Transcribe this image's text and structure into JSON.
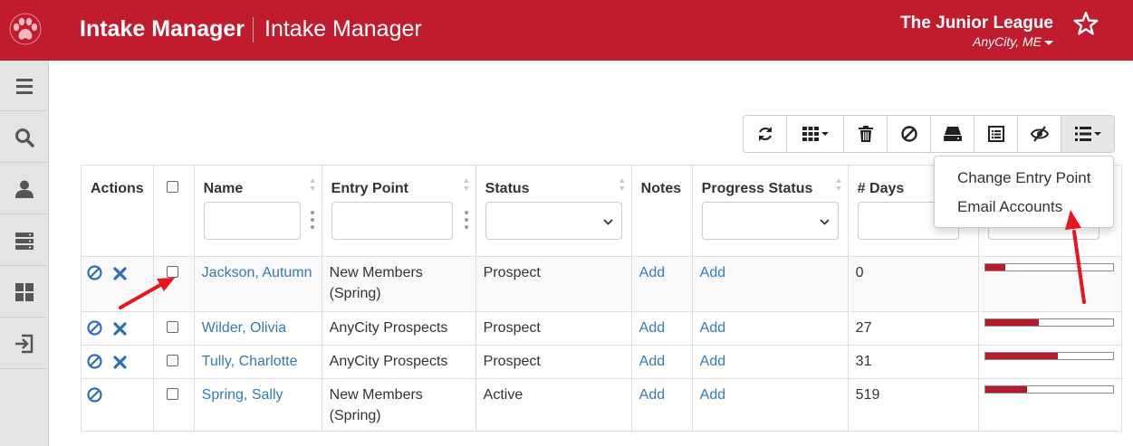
{
  "header": {
    "app_title": "Intake Manager",
    "page_title": "Intake Manager",
    "org_name": "The Junior League",
    "org_location": "AnyCity, ME",
    "brand_color": "#c01c2e"
  },
  "sidebar": {
    "items": [
      {
        "icon": "hamburger-menu-icon"
      },
      {
        "icon": "search-icon"
      },
      {
        "icon": "user-icon"
      },
      {
        "icon": "server-icon"
      },
      {
        "icon": "dashboard-grid-icon"
      },
      {
        "icon": "sign-out-icon"
      }
    ]
  },
  "toolbar": {
    "buttons": [
      {
        "icon": "refresh-icon"
      },
      {
        "icon": "columns-grid-icon"
      },
      {
        "icon": "trash-icon"
      },
      {
        "icon": "ban-icon"
      },
      {
        "icon": "hard-drive-icon"
      },
      {
        "icon": "list-alt-icon"
      },
      {
        "icon": "eye-slash-icon"
      },
      {
        "icon": "list-menu-icon"
      }
    ]
  },
  "dropdown": {
    "items": [
      "Change Entry Point",
      "Email Accounts"
    ]
  },
  "table": {
    "columns": [
      "Actions",
      "",
      "Name",
      "Entry Point",
      "Status",
      "Notes",
      "Progress Status",
      "# Days",
      ""
    ],
    "rows": [
      {
        "name": "Jackson, Autumn",
        "entry_point": "New Members (Spring)",
        "status": "Prospect",
        "notes": "Add",
        "progress_status": "Add",
        "days": "0",
        "progress": 0.16,
        "deletable": true
      },
      {
        "name": "Wilder, Olivia",
        "entry_point": "AnyCity Prospects",
        "status": "Prospect",
        "notes": "Add",
        "progress_status": "Add",
        "days": "27",
        "progress": 0.42,
        "deletable": true
      },
      {
        "name": "Tully, Charlotte",
        "entry_point": "AnyCity Prospects",
        "status": "Prospect",
        "notes": "Add",
        "progress_status": "Add",
        "days": "31",
        "progress": 0.57,
        "deletable": true
      },
      {
        "name": "Spring, Sally",
        "entry_point": "New Members (Spring)",
        "status": "Active",
        "notes": "Add",
        "progress_status": "Add",
        "days": "519",
        "progress": 0.33,
        "deletable": false
      }
    ]
  }
}
